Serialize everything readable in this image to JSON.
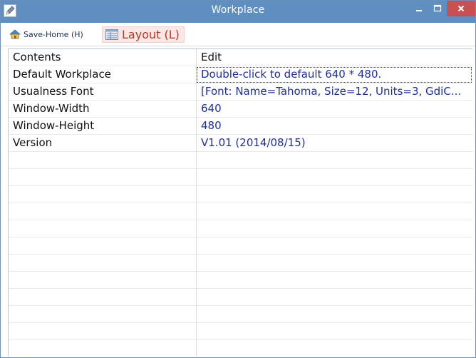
{
  "window": {
    "title": "Workplace",
    "colors": {
      "titlebar": "#5f8ec0",
      "close_button": "#c75050",
      "value_text": "#1f2f9a",
      "layout_tab": "#fbe8e6"
    }
  },
  "toolbar": {
    "save_label": "Save-Home (H)",
    "save_icon": "save-home-icon",
    "layout_label": "Layout (L)",
    "layout_icon": "layout-grid-icon"
  },
  "table": {
    "headers": [
      "Contents",
      "Edit"
    ],
    "rows": [
      {
        "name": "Default Workplace",
        "value": "Double-click to default  640 * 480."
      },
      {
        "name": "Usualness Font",
        "value": "[Font: Name=Tahoma, Size=12, Units=3, GdiC..."
      },
      {
        "name": "Window-Width",
        "value": "640"
      },
      {
        "name": "Window-Height",
        "value": "480"
      },
      {
        "name": "Version",
        "value": "V1.01  (2014/08/15)"
      }
    ],
    "empty_rows": 12
  }
}
